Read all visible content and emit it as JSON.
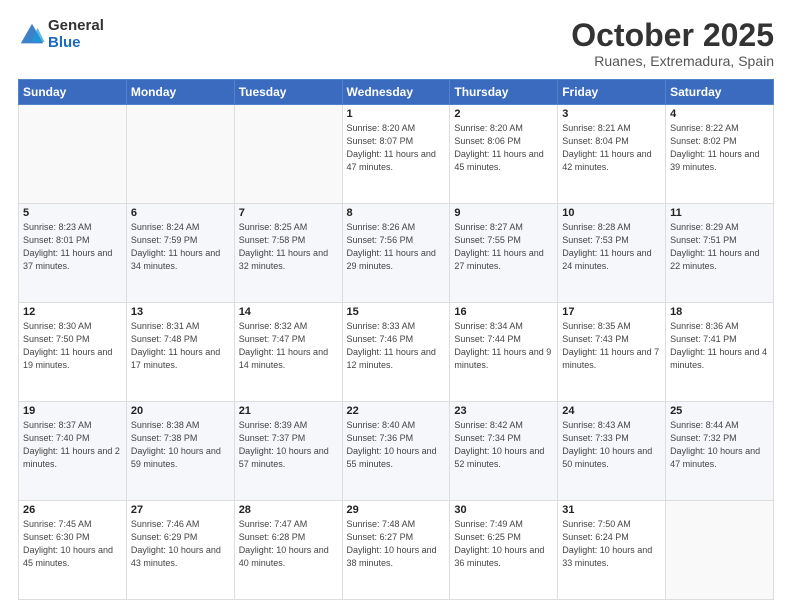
{
  "logo": {
    "general": "General",
    "blue": "Blue"
  },
  "header": {
    "month": "October 2025",
    "location": "Ruanes, Extremadura, Spain"
  },
  "days_of_week": [
    "Sunday",
    "Monday",
    "Tuesday",
    "Wednesday",
    "Thursday",
    "Friday",
    "Saturday"
  ],
  "weeks": [
    [
      {
        "day": "",
        "info": ""
      },
      {
        "day": "",
        "info": ""
      },
      {
        "day": "",
        "info": ""
      },
      {
        "day": "1",
        "info": "Sunrise: 8:20 AM\nSunset: 8:07 PM\nDaylight: 11 hours\nand 47 minutes."
      },
      {
        "day": "2",
        "info": "Sunrise: 8:20 AM\nSunset: 8:06 PM\nDaylight: 11 hours\nand 45 minutes."
      },
      {
        "day": "3",
        "info": "Sunrise: 8:21 AM\nSunset: 8:04 PM\nDaylight: 11 hours\nand 42 minutes."
      },
      {
        "day": "4",
        "info": "Sunrise: 8:22 AM\nSunset: 8:02 PM\nDaylight: 11 hours\nand 39 minutes."
      }
    ],
    [
      {
        "day": "5",
        "info": "Sunrise: 8:23 AM\nSunset: 8:01 PM\nDaylight: 11 hours\nand 37 minutes."
      },
      {
        "day": "6",
        "info": "Sunrise: 8:24 AM\nSunset: 7:59 PM\nDaylight: 11 hours\nand 34 minutes."
      },
      {
        "day": "7",
        "info": "Sunrise: 8:25 AM\nSunset: 7:58 PM\nDaylight: 11 hours\nand 32 minutes."
      },
      {
        "day": "8",
        "info": "Sunrise: 8:26 AM\nSunset: 7:56 PM\nDaylight: 11 hours\nand 29 minutes."
      },
      {
        "day": "9",
        "info": "Sunrise: 8:27 AM\nSunset: 7:55 PM\nDaylight: 11 hours\nand 27 minutes."
      },
      {
        "day": "10",
        "info": "Sunrise: 8:28 AM\nSunset: 7:53 PM\nDaylight: 11 hours\nand 24 minutes."
      },
      {
        "day": "11",
        "info": "Sunrise: 8:29 AM\nSunset: 7:51 PM\nDaylight: 11 hours\nand 22 minutes."
      }
    ],
    [
      {
        "day": "12",
        "info": "Sunrise: 8:30 AM\nSunset: 7:50 PM\nDaylight: 11 hours\nand 19 minutes."
      },
      {
        "day": "13",
        "info": "Sunrise: 8:31 AM\nSunset: 7:48 PM\nDaylight: 11 hours\nand 17 minutes."
      },
      {
        "day": "14",
        "info": "Sunrise: 8:32 AM\nSunset: 7:47 PM\nDaylight: 11 hours\nand 14 minutes."
      },
      {
        "day": "15",
        "info": "Sunrise: 8:33 AM\nSunset: 7:46 PM\nDaylight: 11 hours\nand 12 minutes."
      },
      {
        "day": "16",
        "info": "Sunrise: 8:34 AM\nSunset: 7:44 PM\nDaylight: 11 hours\nand 9 minutes."
      },
      {
        "day": "17",
        "info": "Sunrise: 8:35 AM\nSunset: 7:43 PM\nDaylight: 11 hours\nand 7 minutes."
      },
      {
        "day": "18",
        "info": "Sunrise: 8:36 AM\nSunset: 7:41 PM\nDaylight: 11 hours\nand 4 minutes."
      }
    ],
    [
      {
        "day": "19",
        "info": "Sunrise: 8:37 AM\nSunset: 7:40 PM\nDaylight: 11 hours\nand 2 minutes."
      },
      {
        "day": "20",
        "info": "Sunrise: 8:38 AM\nSunset: 7:38 PM\nDaylight: 10 hours\nand 59 minutes."
      },
      {
        "day": "21",
        "info": "Sunrise: 8:39 AM\nSunset: 7:37 PM\nDaylight: 10 hours\nand 57 minutes."
      },
      {
        "day": "22",
        "info": "Sunrise: 8:40 AM\nSunset: 7:36 PM\nDaylight: 10 hours\nand 55 minutes."
      },
      {
        "day": "23",
        "info": "Sunrise: 8:42 AM\nSunset: 7:34 PM\nDaylight: 10 hours\nand 52 minutes."
      },
      {
        "day": "24",
        "info": "Sunrise: 8:43 AM\nSunset: 7:33 PM\nDaylight: 10 hours\nand 50 minutes."
      },
      {
        "day": "25",
        "info": "Sunrise: 8:44 AM\nSunset: 7:32 PM\nDaylight: 10 hours\nand 47 minutes."
      }
    ],
    [
      {
        "day": "26",
        "info": "Sunrise: 7:45 AM\nSunset: 6:30 PM\nDaylight: 10 hours\nand 45 minutes."
      },
      {
        "day": "27",
        "info": "Sunrise: 7:46 AM\nSunset: 6:29 PM\nDaylight: 10 hours\nand 43 minutes."
      },
      {
        "day": "28",
        "info": "Sunrise: 7:47 AM\nSunset: 6:28 PM\nDaylight: 10 hours\nand 40 minutes."
      },
      {
        "day": "29",
        "info": "Sunrise: 7:48 AM\nSunset: 6:27 PM\nDaylight: 10 hours\nand 38 minutes."
      },
      {
        "day": "30",
        "info": "Sunrise: 7:49 AM\nSunset: 6:25 PM\nDaylight: 10 hours\nand 36 minutes."
      },
      {
        "day": "31",
        "info": "Sunrise: 7:50 AM\nSunset: 6:24 PM\nDaylight: 10 hours\nand 33 minutes."
      },
      {
        "day": "",
        "info": ""
      }
    ]
  ]
}
